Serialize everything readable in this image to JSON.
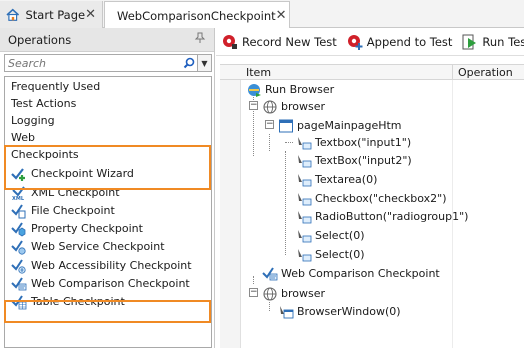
{
  "tabs": [
    {
      "label": "Start Page",
      "icon": "home-icon",
      "close": "✕"
    },
    {
      "label": "WebComparisonCheckpoint",
      "icon": "keyword-test-icon",
      "close": "✕"
    }
  ],
  "left_panel": {
    "title": "Operations",
    "search": {
      "placeholder": "Search",
      "value": ""
    },
    "items": [
      {
        "label": "Frequently Used",
        "icon": ""
      },
      {
        "label": "Test Actions",
        "icon": ""
      },
      {
        "label": "Logging",
        "icon": ""
      },
      {
        "label": "Web",
        "icon": ""
      },
      {
        "label": "Checkpoints",
        "icon": ""
      },
      {
        "label": "Checkpoint Wizard",
        "icon": "checkpoint-wizard-icon"
      },
      {
        "label": "XML Checkpoint",
        "icon": "xml-icon"
      },
      {
        "label": "File Checkpoint",
        "icon": "file-checkpoint-icon"
      },
      {
        "label": "Property Checkpoint",
        "icon": "property-checkpoint-icon"
      },
      {
        "label": "Web Service Checkpoint",
        "icon": "web-service-checkpoint-icon"
      },
      {
        "label": "Web Accessibility Checkpoint",
        "icon": "web-accessibility-checkpoint-icon"
      },
      {
        "label": "Web Comparison Checkpoint",
        "icon": "web-comparison-checkpoint-icon"
      },
      {
        "label": "Table Checkpoint",
        "icon": "table-checkpoint-icon"
      }
    ],
    "highlights": [
      "Checkpoints / Checkpoint Wizard",
      "Web Comparison Checkpoint"
    ],
    "highlight_color": "#f08a24"
  },
  "toolbar": {
    "record_label": "Record New Test",
    "append_label": "Append to Test",
    "run_label": "Run Test"
  },
  "grid": {
    "columns": [
      "Item",
      "Operation"
    ],
    "rows": [
      {
        "label": "Run Browser",
        "icon": "run-browser-icon"
      },
      {
        "label": "browser",
        "icon": "globe-icon"
      },
      {
        "label": "pageMainpageHtm",
        "icon": "page-icon"
      },
      {
        "label": "Textbox(\"input1\")",
        "icon": "checkpoint-icon"
      },
      {
        "label": "TextBox(\"input2\")",
        "icon": "checkpoint-icon"
      },
      {
        "label": "Textarea(0)",
        "icon": "checkpoint-icon"
      },
      {
        "label": "Checkbox(\"checkbox2\")",
        "icon": "checkpoint-icon"
      },
      {
        "label": "RadioButton(\"radiogroup1\")",
        "icon": "checkpoint-icon"
      },
      {
        "label": "Select(0)",
        "icon": "checkpoint-icon"
      },
      {
        "label": "Select(0)",
        "icon": "checkpoint-icon"
      },
      {
        "label": "Web Comparison Checkpoint",
        "icon": "web-comparison-checkpoint-icon"
      },
      {
        "label": "browser",
        "icon": "globe-icon"
      },
      {
        "label": "BrowserWindow(0)",
        "icon": "window-icon"
      }
    ]
  }
}
